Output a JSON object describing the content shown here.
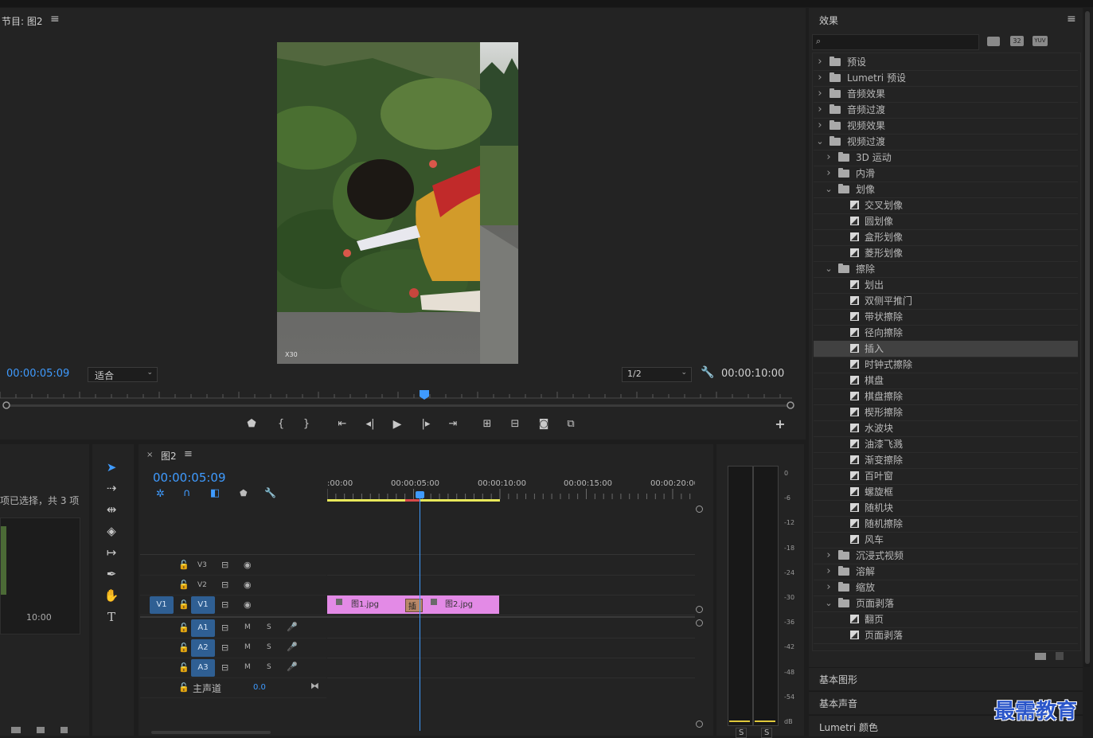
{
  "program_monitor": {
    "title": "节目: 图2",
    "current_time": "00:00:05:09",
    "fit_option": "适合",
    "resolution": "1/2",
    "duration": "00:00:10:00",
    "watermark": "X30"
  },
  "project_panel": {
    "selection_status": "项已选择，共 3 项",
    "thumb_duration": "10:00"
  },
  "timeline": {
    "tab_title": "图2",
    "current_time": "00:00:05:09",
    "ruler_labels": [
      ":00:00",
      "00:00:05:00",
      "00:00:10:00",
      "00:00:15:00",
      "00:00:20:00"
    ],
    "video_tracks": [
      {
        "label": "V3",
        "source": ""
      },
      {
        "label": "V2",
        "source": ""
      },
      {
        "label": "V1",
        "source": "V1"
      }
    ],
    "audio_tracks": [
      {
        "label": "A1",
        "m": "M",
        "s": "S"
      },
      {
        "label": "A2",
        "m": "M",
        "s": "S"
      },
      {
        "label": "A3",
        "m": "M",
        "s": "S"
      }
    ],
    "master": {
      "label": "主声道",
      "value": "0.0"
    },
    "clips": [
      {
        "name": "图1.jpg"
      },
      {
        "name": "图2.jpg"
      }
    ],
    "transition_label": "插"
  },
  "audio_meter": {
    "scale": [
      "0",
      "-6",
      "-12",
      "-18",
      "-24",
      "-30",
      "-36",
      "-42",
      "-48",
      "-54",
      "dB"
    ],
    "solo_labels": [
      "S",
      "S"
    ]
  },
  "effects_panel": {
    "title": "效果",
    "search_placeholder": "",
    "filter_badges": [
      "32",
      "YUV"
    ],
    "tree": [
      {
        "label": "预设",
        "level": 0,
        "type": "folder",
        "open": false
      },
      {
        "label": "Lumetri 预设",
        "level": 0,
        "type": "folder",
        "open": false
      },
      {
        "label": "音频效果",
        "level": 0,
        "type": "folder",
        "open": false
      },
      {
        "label": "音频过渡",
        "level": 0,
        "type": "folder",
        "open": false
      },
      {
        "label": "视频效果",
        "level": 0,
        "type": "folder",
        "open": false
      },
      {
        "label": "视频过渡",
        "level": 0,
        "type": "folder",
        "open": true
      },
      {
        "label": "3D 运动",
        "level": 1,
        "type": "folder",
        "open": false
      },
      {
        "label": "内滑",
        "level": 1,
        "type": "folder",
        "open": false
      },
      {
        "label": "划像",
        "level": 1,
        "type": "folder",
        "open": true
      },
      {
        "label": "交叉划像",
        "level": 2,
        "type": "effect"
      },
      {
        "label": "圆划像",
        "level": 2,
        "type": "effect"
      },
      {
        "label": "盒形划像",
        "level": 2,
        "type": "effect"
      },
      {
        "label": "菱形划像",
        "level": 2,
        "type": "effect"
      },
      {
        "label": "擦除",
        "level": 1,
        "type": "folder",
        "open": true
      },
      {
        "label": "划出",
        "level": 2,
        "type": "effect"
      },
      {
        "label": "双侧平推门",
        "level": 2,
        "type": "effect"
      },
      {
        "label": "带状擦除",
        "level": 2,
        "type": "effect"
      },
      {
        "label": "径向擦除",
        "level": 2,
        "type": "effect"
      },
      {
        "label": "插入",
        "level": 2,
        "type": "effect",
        "selected": true
      },
      {
        "label": "时钟式擦除",
        "level": 2,
        "type": "effect"
      },
      {
        "label": "棋盘",
        "level": 2,
        "type": "effect"
      },
      {
        "label": "棋盘擦除",
        "level": 2,
        "type": "effect"
      },
      {
        "label": "楔形擦除",
        "level": 2,
        "type": "effect"
      },
      {
        "label": "水波块",
        "level": 2,
        "type": "effect"
      },
      {
        "label": "油漆飞溅",
        "level": 2,
        "type": "effect"
      },
      {
        "label": "渐变擦除",
        "level": 2,
        "type": "effect"
      },
      {
        "label": "百叶窗",
        "level": 2,
        "type": "effect"
      },
      {
        "label": "螺旋框",
        "level": 2,
        "type": "effect"
      },
      {
        "label": "随机块",
        "level": 2,
        "type": "effect"
      },
      {
        "label": "随机擦除",
        "level": 2,
        "type": "effect"
      },
      {
        "label": "风车",
        "level": 2,
        "type": "effect"
      },
      {
        "label": "沉浸式视频",
        "level": 1,
        "type": "folder",
        "open": false
      },
      {
        "label": "溶解",
        "level": 1,
        "type": "folder",
        "open": false
      },
      {
        "label": "缩放",
        "level": 1,
        "type": "folder",
        "open": false
      },
      {
        "label": "页面剥落",
        "level": 1,
        "type": "folder",
        "open": true
      },
      {
        "label": "翻页",
        "level": 2,
        "type": "effect"
      },
      {
        "label": "页面剥落",
        "level": 2,
        "type": "effect"
      }
    ],
    "sections": [
      "基本图形",
      "基本声音",
      "Lumetri 颜色"
    ]
  },
  "brand_watermark": "最需教育",
  "colors": {
    "accent_blue": "#3f9bff",
    "clip_pink": "#e38ae6",
    "selection": "#414141"
  }
}
